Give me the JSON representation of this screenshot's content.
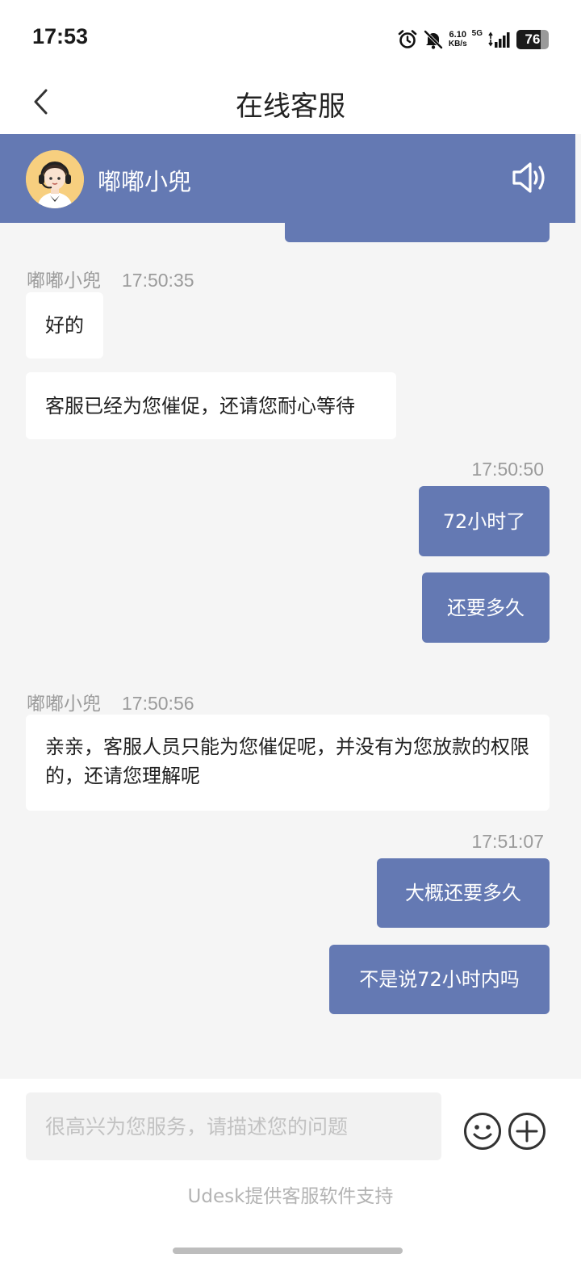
{
  "status_bar": {
    "time": "17:53",
    "net_speed_value": "6.10",
    "net_speed_unit": "KB/s",
    "network_type": "5G",
    "battery_level": "76",
    "battery_fraction": 0.76,
    "icons": [
      "alarm-icon",
      "bell-off-icon",
      "signal-icon",
      "battery-icon"
    ]
  },
  "nav": {
    "title": "在线客服",
    "back_icon": "chevron-left-icon"
  },
  "agent": {
    "name": "嘟嘟小兜",
    "avatar_icon": "agent-headset-avatar",
    "speaker_icon": "speaker-icon"
  },
  "messages": [
    {
      "sender": "嘟嘟小兜",
      "time": "17:50:35",
      "text": "好的",
      "direction": "in"
    },
    {
      "text": "客服已经为您催促，还请您耐心等待",
      "direction": "in"
    },
    {
      "time": "17:50:50",
      "text": "72小时了",
      "direction": "out"
    },
    {
      "text": "还要多久",
      "direction": "out"
    },
    {
      "sender": "嘟嘟小兜",
      "time": "17:50:56",
      "text": "亲亲，客服人员只能为您催促呢，并没有为您放款的权限的，还请您理解呢",
      "direction": "in"
    },
    {
      "time": "17:51:07",
      "text": "大概还要多久",
      "direction": "out"
    },
    {
      "text": "不是说72小时内吗",
      "direction": "out"
    }
  ],
  "input": {
    "placeholder": "很高兴为您服务，请描述您的问题",
    "value": "",
    "emoji_icon": "emoji-icon",
    "plus_icon": "plus-icon"
  },
  "footer": {
    "powered_by": "Udesk提供客服软件支持"
  },
  "colors": {
    "accent": "#6479b3",
    "background": "#f5f5f5",
    "bubble_in": "#ffffff",
    "meta_text": "#9b9b9b"
  }
}
